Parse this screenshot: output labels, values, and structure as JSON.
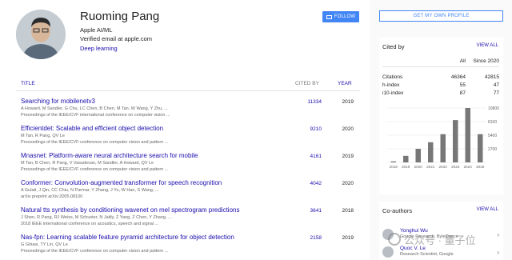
{
  "profile": {
    "name": "Ruoming Pang",
    "affiliation": "Apple AI/ML",
    "email": "Verified email at apple.com",
    "interest": "Deep learning",
    "follow_label": "FOLLOW"
  },
  "table": {
    "title_header": "TITLE",
    "cited_header": "CITED BY",
    "year_header": "YEAR",
    "rows": [
      {
        "title": "Searching for mobilenetv3",
        "authors": "A Howard, M Sandler, G Chu, LC Chen, B Chen, M Tan, W Wang, Y Zhu, ...",
        "venue": "Proceedings of the IEEE/CVF international conference on computer vision ...",
        "venue2": "",
        "cited": "11334",
        "year": "2019"
      },
      {
        "title": "Efficientdet: Scalable and efficient object detection",
        "authors": "M Tan, R Pang, QV Le",
        "venue": "Proceedings of the IEEE/CVF conference on computer vision and pattern ...",
        "venue2": "",
        "cited": "9210",
        "year": "2020"
      },
      {
        "title": "Mnasnet: Platform-aware neural architecture search for mobile",
        "authors": "M Tan, B Chen, R Pang, V Vasudevan, M Sandler, A Howard, QV Le",
        "venue": "Proceedings of the IEEE/CVF conference on computer vision and pattern ...",
        "venue2": "",
        "cited": "4161",
        "year": "2019"
      },
      {
        "title": "Conformer: Convolution-augmented transformer for speech recognition",
        "authors": "A Gulati, J Qin, CC Chiu, N Parmar, Y Zhang, J Yu, W Han, S Wang, ...",
        "venue": "arXiv preprint arXiv:2005.08100",
        "venue2": "",
        "cited": "4042",
        "year": "2020"
      },
      {
        "title": "Natural tts synthesis by conditioning wavenet on mel spectrogram predictions",
        "authors": "J Shen, R Pang, RJ Weiss, M Schuster, N Jaitly, Z Yang, Z Chen, Y Zhang, ...",
        "venue": "2018 IEEE international conference on acoustics, speech and signal ...",
        "venue2": "",
        "cited": "3641",
        "year": "2018"
      },
      {
        "title": "Nas-fpn: Learning scalable feature pyramid architecture for object detection",
        "authors": "G Ghiasi, TY Lin, QV Le",
        "venue": "Proceedings of the IEEE/CVF conference on computer vision and pattern ...",
        "venue2": "",
        "cited": "2158",
        "year": "2019"
      }
    ]
  },
  "sidebar": {
    "get_profile_label": "GET MY OWN PROFILE",
    "cited_by": {
      "heading": "Cited by",
      "view_all": "VIEW ALL",
      "col_all": "All",
      "col_since": "Since 2020",
      "rows": [
        {
          "label": "Citations",
          "all": "46364",
          "since": "42815"
        },
        {
          "label": "h-index",
          "all": "55",
          "since": "47"
        },
        {
          "label": "i10-index",
          "all": "87",
          "since": "77"
        }
      ]
    },
    "coauthors": {
      "heading": "Co-authors",
      "view_all": "VIEW ALL",
      "items": [
        {
          "name": "Yonghui Wu",
          "affiliation": "Google Research, ByteDance"
        },
        {
          "name": "Quoc V. Le",
          "affiliation": "Research Scientist, Google"
        }
      ]
    }
  },
  "chart_data": {
    "type": "bar",
    "categories": [
      "2018",
      "2019",
      "2020",
      "2021",
      "2022",
      "2023",
      "2024",
      "2025"
    ],
    "values": [
      200,
      1300,
      2700,
      4000,
      5600,
      8400,
      10800,
      5600
    ],
    "yticks": [
      "0",
      "2700",
      "5400",
      "8100",
      "10800"
    ],
    "ylim": [
      0,
      10800
    ],
    "grid": true,
    "color": "#777777"
  },
  "watermark": {
    "text": "公众号 · 量子位"
  },
  "colors": {
    "link": "#1a0dab",
    "accent": "#4285f4",
    "panel": "#fafafa"
  }
}
